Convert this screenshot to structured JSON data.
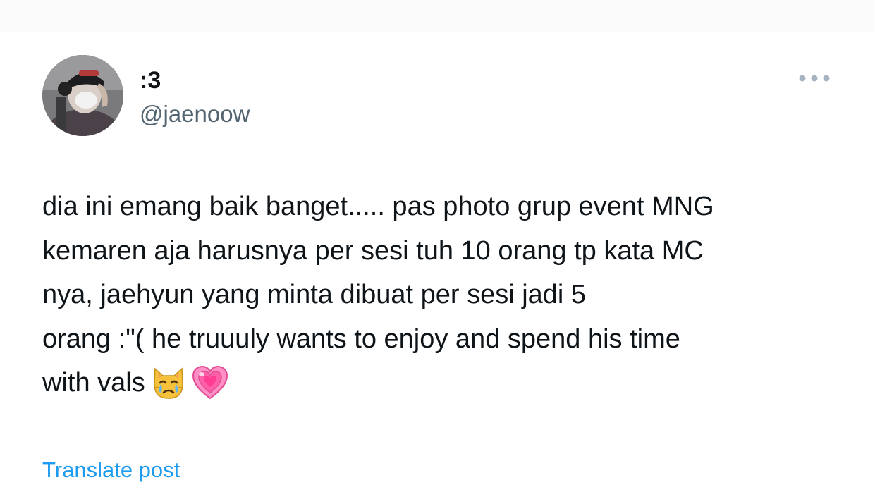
{
  "post": {
    "author": {
      "display_name": ":3",
      "handle": "@jaenoow",
      "avatar_icon": "profile-photo"
    },
    "more_icon": "more-horizontal-icon",
    "text_lines": [
      "dia ini emang baik banget..... pas photo grup event MNG",
      "kemaren aja harusnya per sesi tuh 10 orang tp kata MC",
      "nya, jaehyun yang minta dibuat per sesi jadi 5",
      "orang :\"( he truuuly wants to enjoy and spend his time",
      "with vals"
    ],
    "emojis": [
      "crying-cat-icon",
      "growing-heart-icon"
    ],
    "translate_label": "Translate post"
  },
  "colors": {
    "text": "#0f1419",
    "secondary_text": "#536471",
    "link": "#1d9bf0",
    "more_dots": "#a5b4c0"
  }
}
